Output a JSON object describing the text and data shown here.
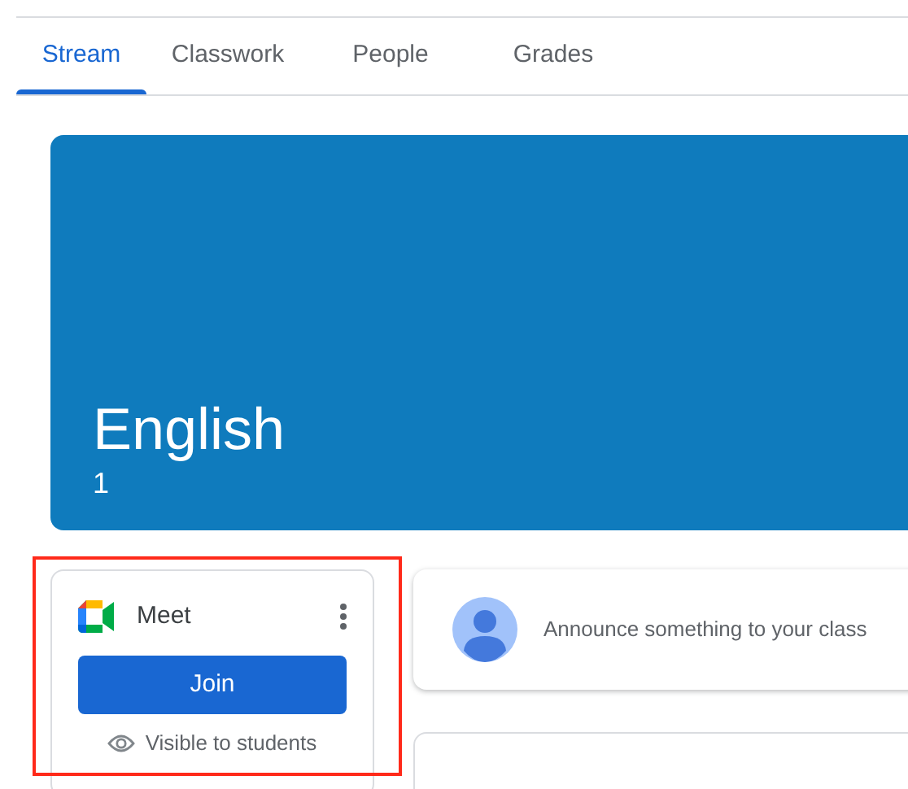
{
  "tabs": [
    {
      "label": "Stream",
      "selected": true
    },
    {
      "label": "Classwork",
      "selected": false
    },
    {
      "label": "People",
      "selected": false
    },
    {
      "label": "Grades",
      "selected": false
    }
  ],
  "banner": {
    "title": "English",
    "section": "1"
  },
  "meet_card": {
    "title": "Meet",
    "button": "Join",
    "visibility": "Visible to students",
    "highlighted": true
  },
  "announce": {
    "placeholder": "Announce something to your class"
  }
}
